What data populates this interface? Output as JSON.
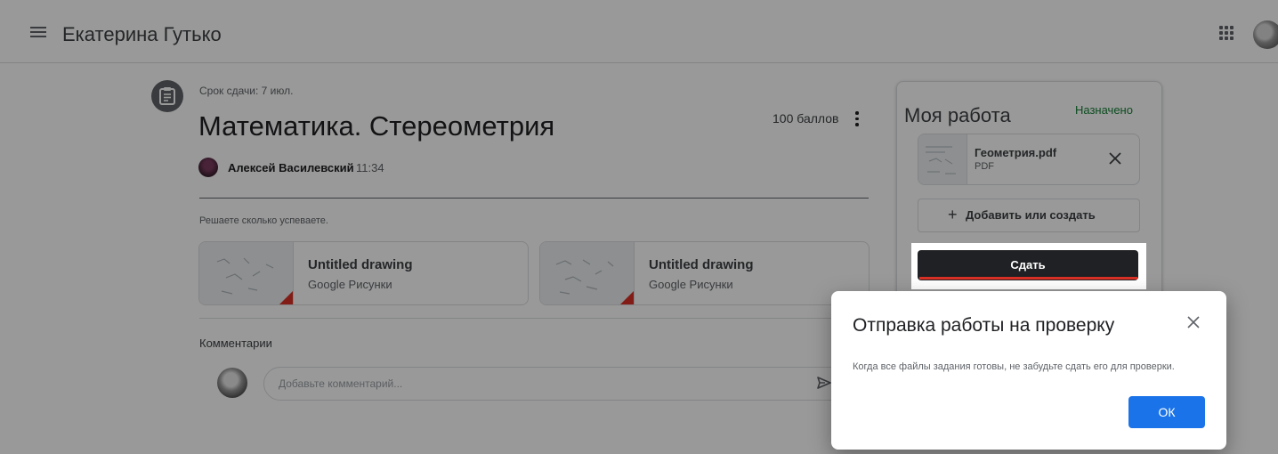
{
  "header": {
    "user_name": "Екатерина Гутько"
  },
  "assignment": {
    "due": "Срок сдачи: 7 июл.",
    "title": "Математика. Стереометрия",
    "points": "100 баллов",
    "teacher": "Алексей Василевский",
    "time": "11:34",
    "instructions": "Решаете сколько успеваете.",
    "attachments": [
      {
        "title": "Untitled drawing",
        "subtitle": "Google Рисунки"
      },
      {
        "title": "Untitled drawing",
        "subtitle": "Google Рисунки"
      }
    ]
  },
  "comments": {
    "label": "Комментарии",
    "placeholder": "Добавьте комментарий..."
  },
  "my_work": {
    "title": "Моя работа",
    "status": "Назначено",
    "file": {
      "name": "Геометрия.pdf",
      "type": "PDF"
    },
    "add_label": "Добавить или создать",
    "add_symbol": "+",
    "submit_label": "Сдать"
  },
  "dialog": {
    "title": "Отправка работы на проверку",
    "body": "Когда все файлы задания готовы, не забудьте сдать его для проверки.",
    "ok_label": "ОК"
  },
  "colors": {
    "status_green": "#188038",
    "primary_blue": "#1a73e8",
    "accent_red": "#d93025"
  },
  "icons": {
    "menu": "hamburger-menu-icon",
    "apps": "apps-grid-icon",
    "assignment": "assignment-icon",
    "more": "more-vert-icon",
    "remove": "close-icon",
    "send": "send-icon"
  }
}
